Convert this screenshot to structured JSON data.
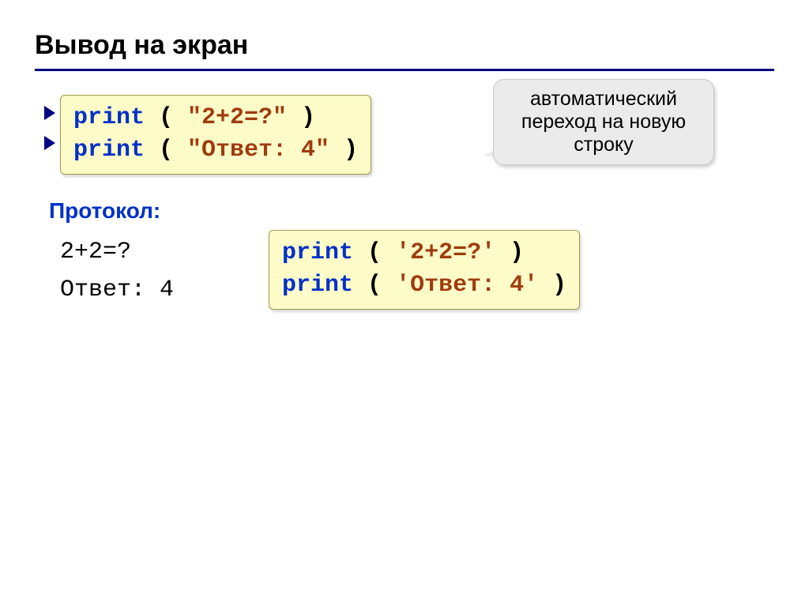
{
  "title": "Вывод на экран",
  "callout": "автоматический переход на новую строку",
  "code1": {
    "l1": {
      "kw": "print",
      "open": " ( ",
      "str": "\"2+2=?\"",
      "close": " )"
    },
    "l2": {
      "kw": "print",
      "open": " ( ",
      "str": "\"Ответ: 4\"",
      "close": " )"
    }
  },
  "protocol_label": "Протокол:",
  "output": {
    "l1": "2+2=?",
    "l2": "Ответ: 4"
  },
  "code2": {
    "l1": {
      "kw": "print",
      "open": " ( ",
      "str": "'2+2=?'",
      "close": " )"
    },
    "l2": {
      "kw": "print",
      "open": " ( ",
      "str": "'Ответ: 4'",
      "close": " )"
    }
  }
}
